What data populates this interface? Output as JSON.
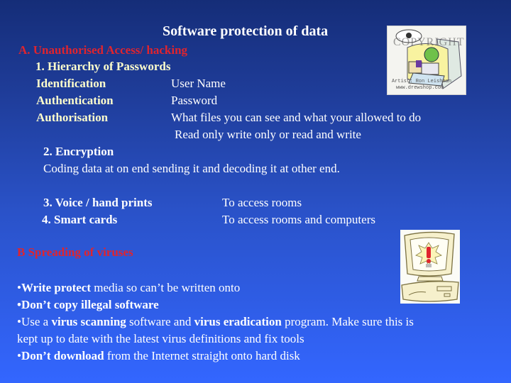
{
  "title": "Software protection of data",
  "section_a": {
    "heading": "A. Unauthorised Access/ hacking",
    "item1": "1.  Hierarchy of Passwords",
    "rows": [
      {
        "term": "Identification",
        "desc": "User Name"
      },
      {
        "term": "Authentication",
        "desc": "Password"
      },
      {
        "term": "Authorisation",
        "desc": "What files you can see and what your allowed to do"
      }
    ],
    "authorisation_extra": "Read only write only  or read and write",
    "item2_title": "2. Encryption",
    "item2_desc": "Coding data at on end sending it and decoding it at other end.",
    "item3_title": "3. Voice / hand prints",
    "item3_desc": "To access rooms",
    "item4_title": "4.  Smart cards",
    "item4_desc": "To access rooms and computers"
  },
  "section_b": {
    "heading": "B Spreading of viruses",
    "bullets": [
      {
        "bold": "Write protect",
        "rest": " media so can’t be written onto"
      },
      {
        "bold": "Don’t copy illegal software",
        "rest": ""
      },
      {
        "pre": "Use a ",
        "bold1": "virus scanning",
        "mid": " software and ",
        "bold2": "virus eradication",
        "rest": " program. Make sure this is",
        "line2": "kept up to date with the latest virus definitions and fix tools"
      },
      {
        "bold": "Don’t download",
        "rest": " from the Internet straight onto hard disk"
      }
    ],
    "bullet_glyph": "•"
  },
  "images": {
    "clipart_top": {
      "icon": "hacker-cartoon-icon",
      "watermark": "COPYRIGHT",
      "credit1": "Artist: Ron Leishman",
      "credit2": "www.drewshop.com"
    },
    "clipart_bottom": {
      "icon": "computer-warning-icon",
      "symbol": "!"
    }
  }
}
